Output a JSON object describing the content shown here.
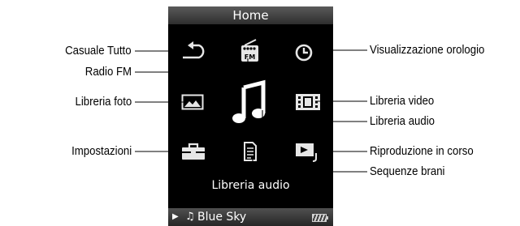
{
  "screen": {
    "title": "Home",
    "caption": "Libreria audio",
    "now_playing": "Blue Sky"
  },
  "icons": [
    "shuffle-all-icon",
    "fm-radio-icon",
    "clock-icon",
    "photo-library-icon",
    "music-note-icon",
    "video-library-icon",
    "settings-toolbox-icon",
    "playlist-icon",
    "now-playing-icon"
  ],
  "callouts": {
    "shuffle_all": "Casuale Tutto",
    "fm_radio": "Radio FM",
    "photo_library": "Libreria foto",
    "settings": "Impostazioni",
    "clock_display": "Visualizzazione orologio",
    "video_library": "Libreria video",
    "music_library": "Libreria audio",
    "now_playing": "Riproduzione in corso",
    "playlists": "Sequenze brani"
  },
  "colors": {
    "screen_bg": "#000000",
    "icon": "#e6e6e6",
    "selected_icon": "#ffffff"
  }
}
